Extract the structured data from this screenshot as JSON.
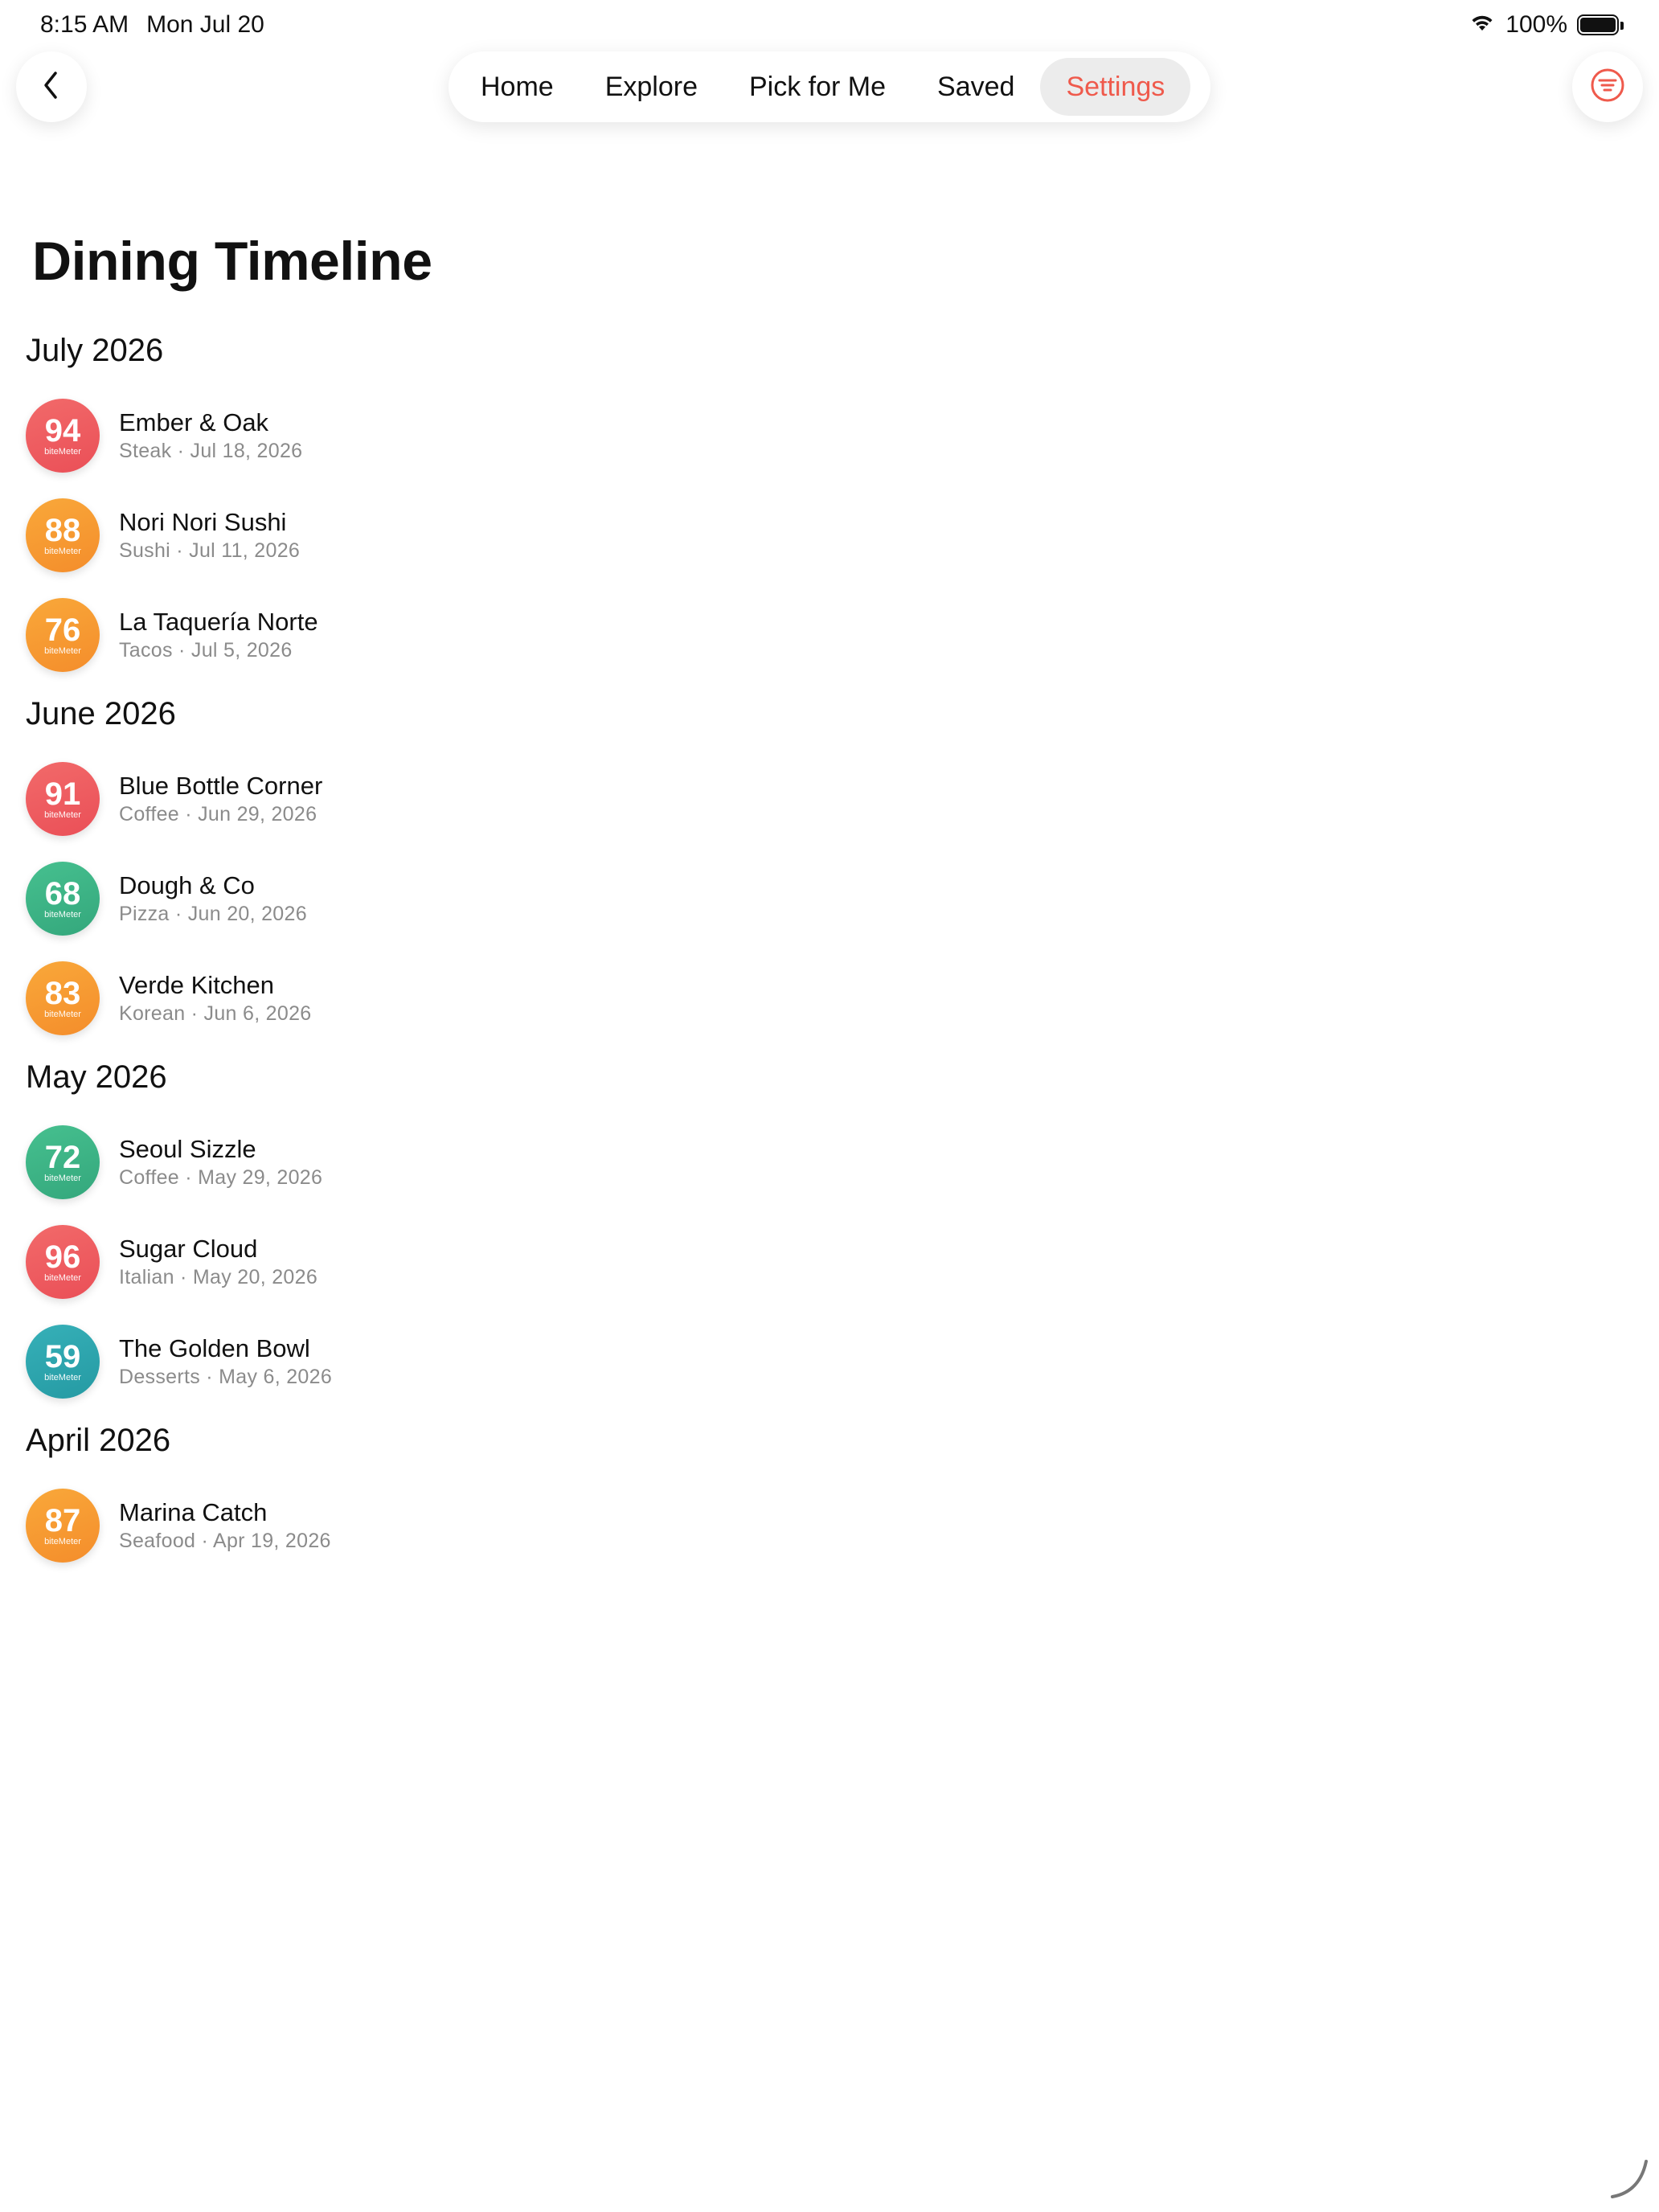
{
  "status_bar": {
    "time": "8:15 AM",
    "date": "Mon Jul 20",
    "battery": "100%",
    "icons": [
      "wifi-icon",
      "battery-icon"
    ]
  },
  "nav": {
    "back_icon": "chevron-left-icon",
    "filter_icon": "filter-lines-icon",
    "tabs": [
      {
        "label": "Home"
      },
      {
        "label": "Explore"
      },
      {
        "label": "Pick for Me"
      },
      {
        "label": "Saved"
      },
      {
        "label": "Settings"
      }
    ],
    "active_tab": "Settings"
  },
  "colors": {
    "accent": "#ef5a4c",
    "red": "#ec5659",
    "orange": "#f6972f",
    "green": "#3bb284",
    "teal": "#2ba3ab"
  },
  "page": {
    "title": "Dining Timeline",
    "score_brand": "biteMeter"
  },
  "months": [
    {
      "label": "July 2026",
      "entries": [
        {
          "score": "94",
          "color": "red",
          "name": "Ember & Oak",
          "meta": "Steak · Jul 18, 2026"
        },
        {
          "score": "88",
          "color": "orange",
          "name": "Nori Nori Sushi",
          "meta": "Sushi · Jul 11, 2026"
        },
        {
          "score": "76",
          "color": "orange",
          "name": "La Taquería Norte",
          "meta": "Tacos · Jul 5, 2026"
        }
      ]
    },
    {
      "label": "June 2026",
      "entries": [
        {
          "score": "91",
          "color": "red",
          "name": "Blue Bottle Corner",
          "meta": "Coffee · Jun 29, 2026"
        },
        {
          "score": "68",
          "color": "green",
          "name": "Dough & Co",
          "meta": "Pizza · Jun 20, 2026"
        },
        {
          "score": "83",
          "color": "orange",
          "name": "Verde Kitchen",
          "meta": "Korean · Jun 6, 2026"
        }
      ]
    },
    {
      "label": "May 2026",
      "entries": [
        {
          "score": "72",
          "color": "green",
          "name": "Seoul Sizzle",
          "meta": "Coffee · May 29, 2026"
        },
        {
          "score": "96",
          "color": "red",
          "name": "Sugar Cloud",
          "meta": "Italian · May 20, 2026"
        },
        {
          "score": "59",
          "color": "teal",
          "name": "The Golden Bowl",
          "meta": "Desserts · May 6, 2026"
        }
      ]
    },
    {
      "label": "April 2026",
      "entries": [
        {
          "score": "87",
          "color": "orange",
          "name": "Marina Catch",
          "meta": "Seafood · Apr 19, 2026"
        }
      ]
    }
  ]
}
